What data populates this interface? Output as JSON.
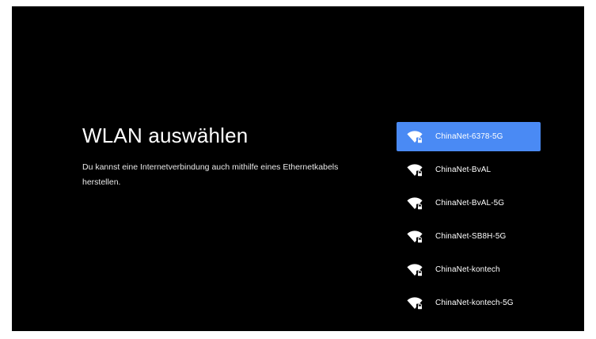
{
  "page": {
    "title": "WLAN auswählen",
    "subtitle": "Du kannst eine Internetverbindung auch mithilfe eines Ethernetkabels herstellen."
  },
  "networks": [
    {
      "name": "ChinaNet-6378-5G",
      "icon": "wifi-lock-icon",
      "selected": true
    },
    {
      "name": "ChinaNet-BvAL",
      "icon": "wifi-lock-icon",
      "selected": false
    },
    {
      "name": "ChinaNet-BvAL-5G",
      "icon": "wifi-lock-icon",
      "selected": false
    },
    {
      "name": "ChinaNet-SB8H-5G",
      "icon": "wifi-lock-icon",
      "selected": false
    },
    {
      "name": "ChinaNet-kontech",
      "icon": "wifi-lock-icon",
      "selected": false
    },
    {
      "name": "ChinaNet-kontech-5G",
      "icon": "wifi-lock-icon",
      "selected": false
    }
  ],
  "colors": {
    "background": "#000000",
    "selected": "#4a8af4",
    "text": "#ffffff"
  }
}
